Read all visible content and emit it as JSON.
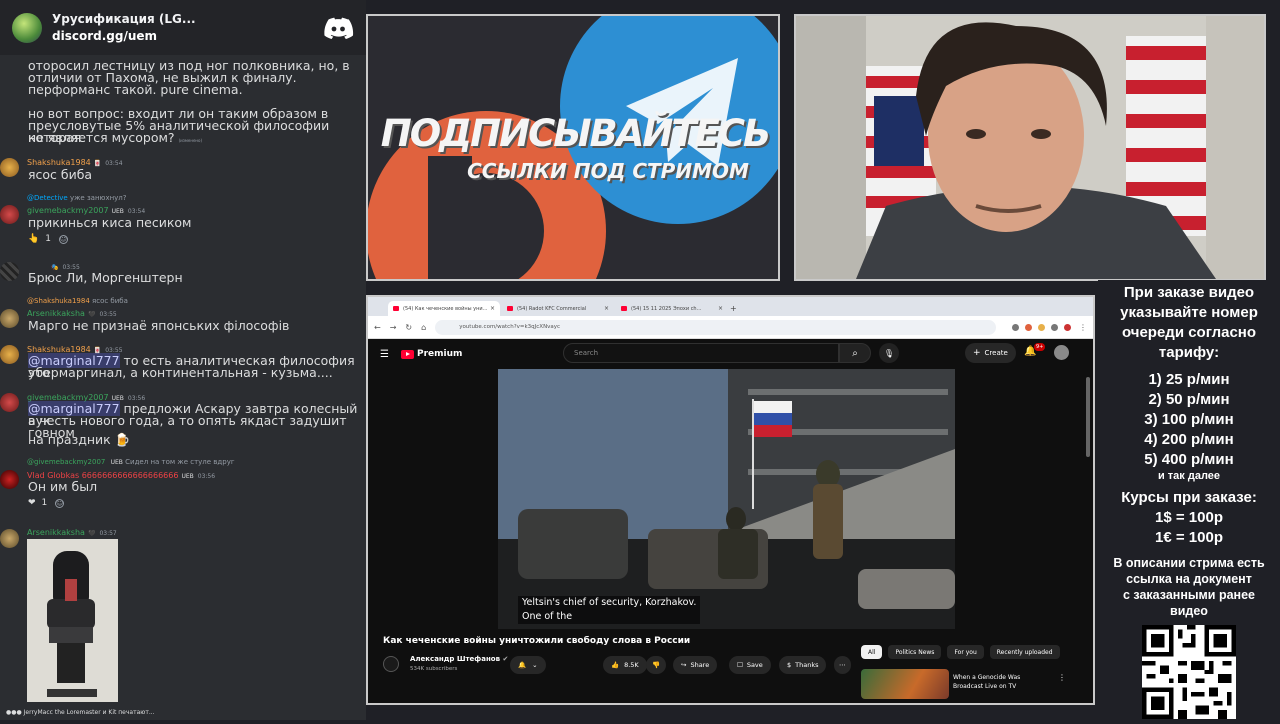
{
  "chat_header": {
    "server_title": "Урусификация (LG...",
    "invite": "discord.gg/uem"
  },
  "messages": {
    "m1_line1": "оторосил лестницу из под ног полковника, но, в",
    "m1_line2": "отличии от Пахома, не выжил к финалу.",
    "m1_line3": "перформанс такой. pure cinema.",
    "m1_line4": "но вот вопрос: входит ли он таким образом в",
    "m1_line5": "преусловутые 5% аналитической философии которая",
    "m1_line6": "не является мусором?",
    "m1_edited": "(изменено)",
    "m2_user": "Shakshuka1984",
    "m2_time": "03:54",
    "m2_text": "ясос биба",
    "m3_reply_user": "@Detective",
    "m3_reply_text": "уже занюхнул?",
    "m3_user": "givemebackmy2007",
    "m3_badge": "UEB",
    "m3_time": "03:54",
    "m3_text": "прикинься киса песиком",
    "m3_react_count": "1",
    "m4_time": "03:55",
    "m4_text": "Брюс Ли, Моргенштерн",
    "m5_reply_user": "@Shakshuka1984",
    "m5_reply_text": "ясос биба",
    "m5_user": "Arsenikkaksha",
    "m5_time": "03:55",
    "m5_text": "Марго не признаё японських філософів",
    "m6_user": "Shakshuka1984",
    "m6_time": "03:55",
    "m6_mention": "@marginal777",
    "m6_text_a": " то есть аналитическая философия это",
    "m6_text_b": "убермаргинал, а континентальная - кузьма....",
    "m7_user": "givemebackmy2007",
    "m7_badge": "UEB",
    "m7_time": "03:56",
    "m7_mention": "@marginal777",
    "m7_text_a": " предложи Аскару завтра колесный аук",
    "m7_text_b": "в честь нового года, а то опять якдаст задушит говном",
    "m7_text_c": "на праздник",
    "m8_reply_user": "@givemebackmy2007",
    "m8_reply_badge": "UEB",
    "m8_reply_text": "Сидел на том же стуле вдруг",
    "m8_user": "Vlad Globkas 6666666666666666666",
    "m8_badge": "UEB",
    "m8_time": "03:56",
    "m8_text": "Он им был",
    "m8_react_count": "1",
    "m9_user": "Arsenikkaksha",
    "m9_time": "03:57",
    "typing": "JerryMacc the Loremaster и Kit печатают..."
  },
  "subscribe_banner": {
    "line1": "ПОДПИСЫВАЙТЕСЬ",
    "line2": "ССЫЛКИ ПОД СТРИМОМ"
  },
  "browser": {
    "tabs": [
      "(54) Как чеченские войны уни...",
      "(54) Radot KFC Commercial",
      "(54) 15 11 2025 Эпохи ch..."
    ],
    "url": "youtube.com/watch?v=k3qJcXNvayc"
  },
  "youtube": {
    "brand": "Premium",
    "search_placeholder": "Search",
    "create": "Create",
    "notif_count": "9+",
    "subtitle_line1": "Yeltsin's chief of security, Korzhakov.",
    "subtitle_line2": "One of the",
    "video_title": "Как чеченские войны уничтожили свободу слова в России",
    "channel": "Александр Штефанов",
    "subscribers": "534K subscribers",
    "likes": "8.5K",
    "share": "Share",
    "save": "Save",
    "thanks": "Thanks",
    "chips": [
      "All",
      "Politics News",
      "For you",
      "Recently uploaded"
    ],
    "rec_title_1": "When a Genocide Was",
    "rec_title_2": "Broadcast Live on TV"
  },
  "info_panel": {
    "order_l1": "При заказе видео",
    "order_l2": "указывайте номер",
    "order_l3": "очереди согласно",
    "order_l4": "тарифу:",
    "prices": [
      "1) 25 р/мин",
      "2) 50 р/мин",
      "3) 100 р/мин",
      "4) 200 р/мин",
      "5) 400 р/мин"
    ],
    "etc": "и так далее",
    "rates_title": "Курсы при заказе:",
    "rate_usd": "1$ = 100р",
    "rate_eur": "1€ = 100р",
    "desc_l1": "В описании стрима есть",
    "desc_l2": "ссылка на документ",
    "desc_l3": "с заказанными ранее",
    "desc_l4": "видео"
  },
  "colors": {
    "discord_bg": "#2b2d31",
    "yt_red": "#ff0033",
    "username_orange": "#f0a04b",
    "username_green": "#3ba55d"
  }
}
